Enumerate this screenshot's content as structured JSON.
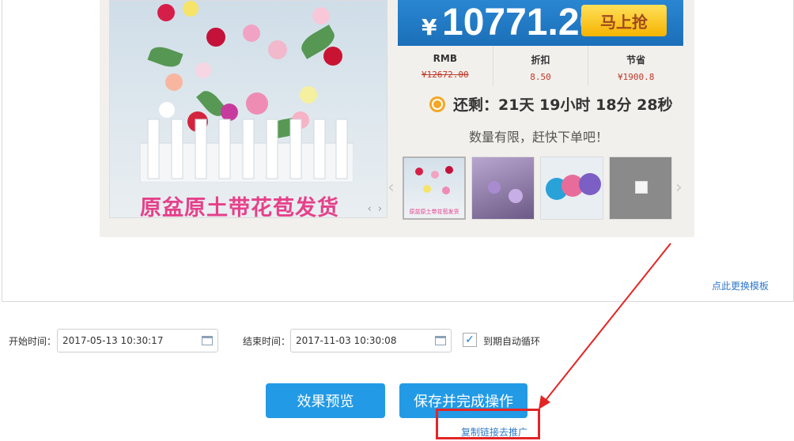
{
  "promo": {
    "main_image_caption": "原盆原土带花苞发货",
    "price_symbol": "¥",
    "price": "10771.20",
    "buy_label": "马上抢",
    "stats": [
      {
        "label": "RMB",
        "value": "¥12672.00",
        "strike": true
      },
      {
        "label": "折扣",
        "value": "8.50",
        "strike": false
      },
      {
        "label": "节省",
        "value": "¥1900.8",
        "strike": false
      }
    ],
    "countdown": "还剩：21天 19小时 18分 28秒",
    "limited_text": "数量有限，赶快下单吧！",
    "thumbnails": [
      {
        "caption": "原盆原土带花苞发货"
      },
      {
        "caption": ""
      },
      {
        "caption": ""
      },
      {
        "caption": ""
      }
    ]
  },
  "change_template_link": "点此更换模板",
  "form": {
    "start_label": "开始时间：",
    "start_value": "2017-05-13 10:30:17",
    "end_label": "结束时间：",
    "end_value": "2017-11-03 10:30:08",
    "auto_loop_checked": true,
    "auto_loop_label": "到期自动循环"
  },
  "actions": {
    "preview_label": "效果预览",
    "save_label": "保存并完成操作",
    "copy_link_label": "复制链接去推广"
  },
  "colors": {
    "primary_button": "#229ae6",
    "price_banner": "#1b6fb8",
    "buy_button": "#f6b400",
    "annotation_red": "#e32525",
    "link": "#3179c9"
  }
}
